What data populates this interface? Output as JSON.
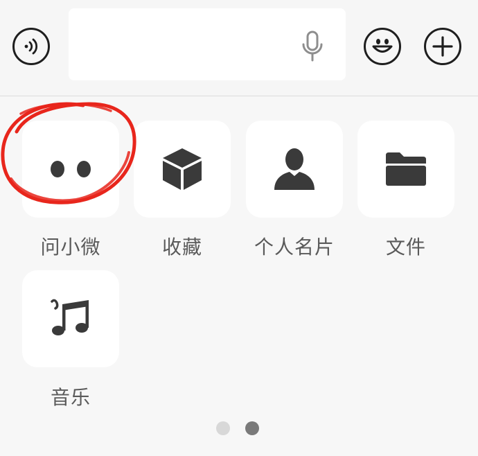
{
  "input_bar": {
    "voice_icon": "voice-mode-icon",
    "mic_icon": "microphone-icon",
    "emoji_icon": "smiley-face-icon",
    "plus_icon": "plus-icon",
    "text_value": ""
  },
  "apps": [
    {
      "label": "问小微",
      "icon": "two-dots-icon"
    },
    {
      "label": "收藏",
      "icon": "cube-icon"
    },
    {
      "label": "个人名片",
      "icon": "person-icon"
    },
    {
      "label": "文件",
      "icon": "folder-icon"
    },
    {
      "label": "音乐",
      "icon": "music-note-icon"
    }
  ],
  "pagination": {
    "pages": 2,
    "current": 2
  },
  "colors": {
    "icon": "#3a3a3a",
    "label": "#5a5a5a",
    "annotation": "#e8261c",
    "dot_active": "#7a7a7a",
    "dot_inactive": "#d8d8d8"
  }
}
